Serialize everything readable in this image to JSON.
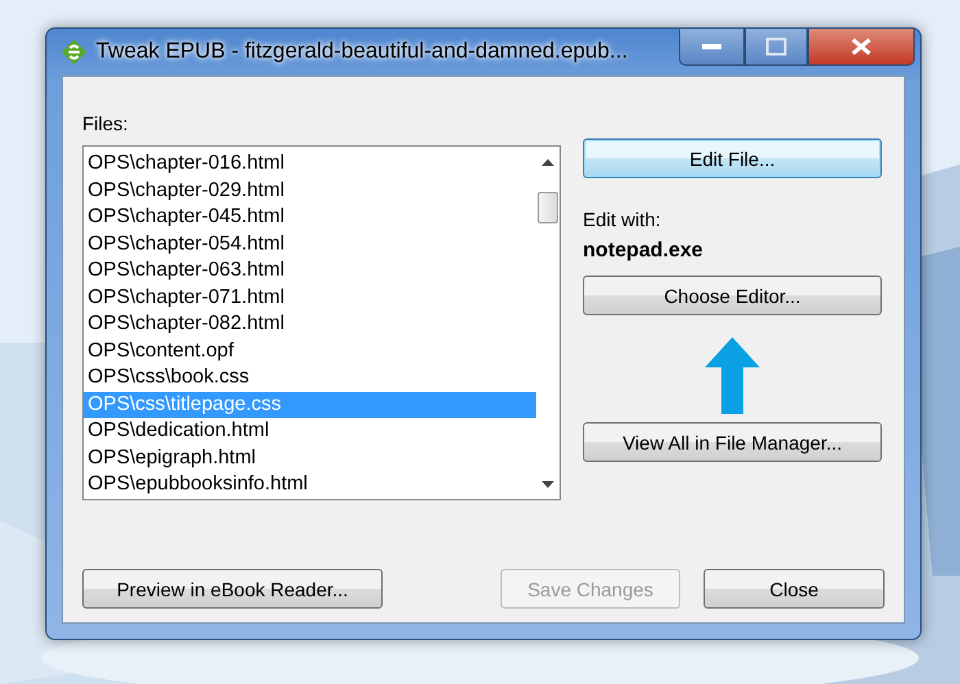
{
  "window": {
    "title": "Tweak EPUB - fitzgerald-beautiful-and-damned.epub..."
  },
  "files": {
    "label": "Files:",
    "items": [
      {
        "name": "OPS\\chapter-016.html",
        "selected": false
      },
      {
        "name": "OPS\\chapter-029.html",
        "selected": false
      },
      {
        "name": "OPS\\chapter-045.html",
        "selected": false
      },
      {
        "name": "OPS\\chapter-054.html",
        "selected": false
      },
      {
        "name": "OPS\\chapter-063.html",
        "selected": false
      },
      {
        "name": "OPS\\chapter-071.html",
        "selected": false
      },
      {
        "name": "OPS\\chapter-082.html",
        "selected": false
      },
      {
        "name": "OPS\\content.opf",
        "selected": false
      },
      {
        "name": "OPS\\css\\book.css",
        "selected": false
      },
      {
        "name": "OPS\\css\\titlepage.css",
        "selected": true
      },
      {
        "name": "OPS\\dedication.html",
        "selected": false
      },
      {
        "name": "OPS\\epigraph.html",
        "selected": false
      },
      {
        "name": "OPS\\epubbooksinfo.html",
        "selected": false
      }
    ]
  },
  "edit_button": {
    "label": "Edit File..."
  },
  "edit_with": {
    "label": "Edit with:",
    "value": "notepad.exe"
  },
  "choose_button": {
    "label": "Choose Editor..."
  },
  "view_all_button": {
    "label": "View All in File Manager..."
  },
  "footer": [
    {
      "label": "Preview in eBook Reader...",
      "disabled": false
    },
    {
      "label": "Save Changes",
      "disabled": true
    },
    {
      "label": "Close",
      "disabled": false
    }
  ]
}
